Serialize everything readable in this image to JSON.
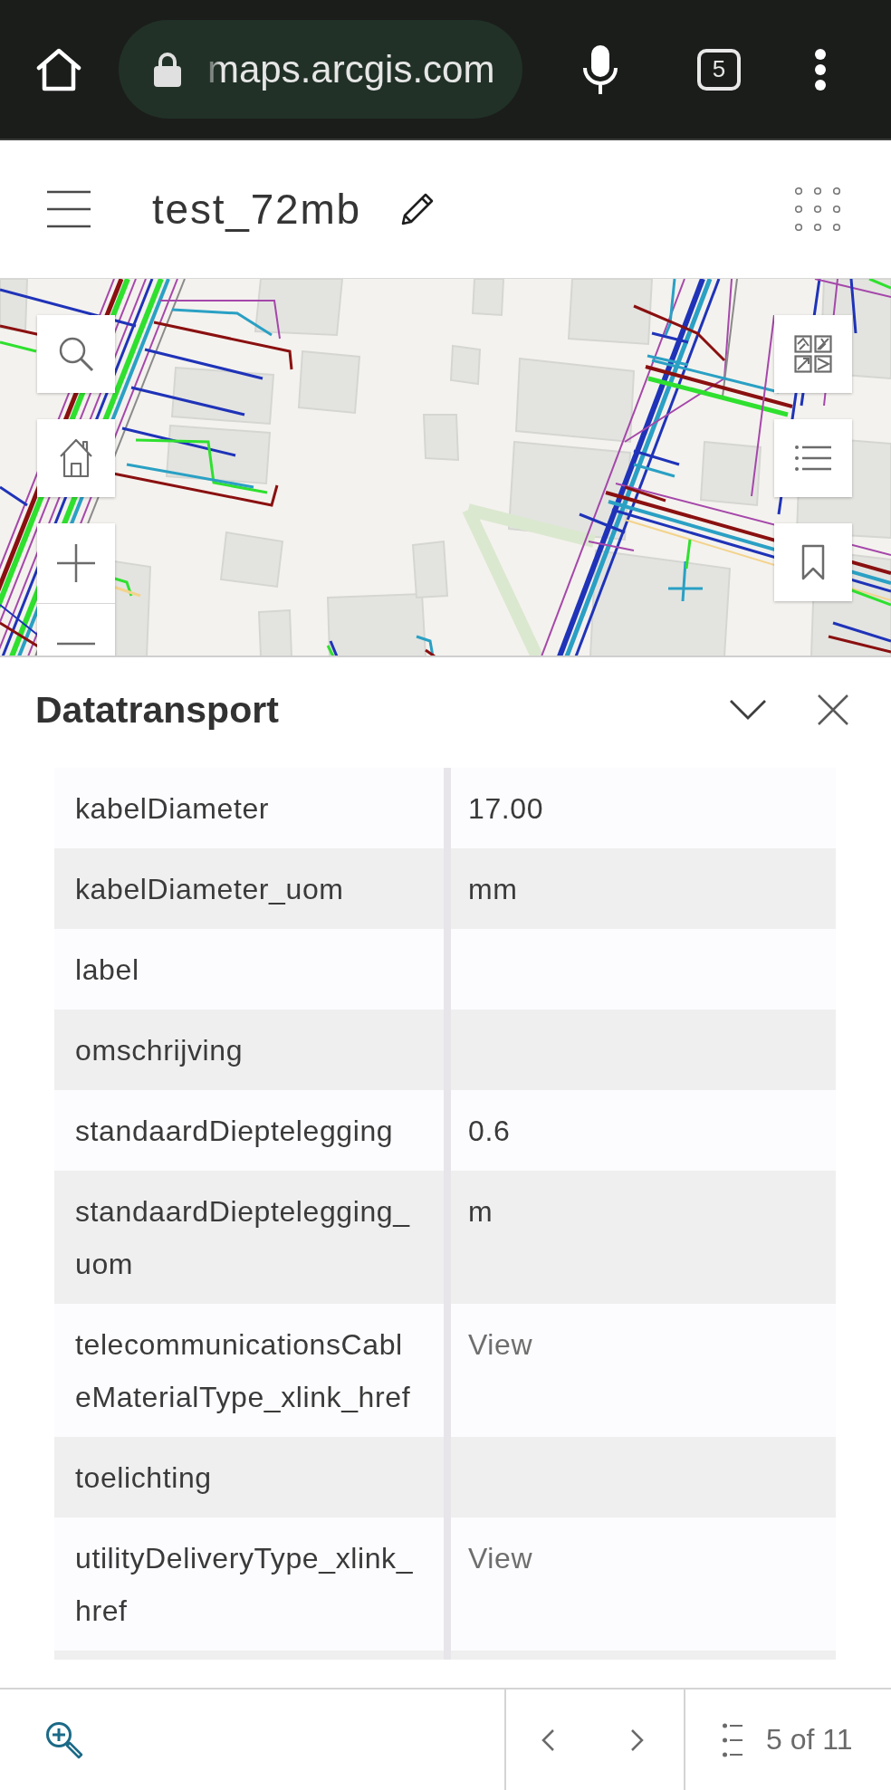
{
  "browser": {
    "url": "maps.arcgis.com",
    "tab_count": "5"
  },
  "app_header": {
    "title": "test_72mb"
  },
  "popup": {
    "title": "Datatransport",
    "fields": [
      {
        "name": "kabelDiameter",
        "value": "17.00",
        "kind": "text"
      },
      {
        "name": "kabelDiameter_uom",
        "value": "mm",
        "kind": "text"
      },
      {
        "name": "label"
      },
      {
        "name": "omschrijving"
      },
      {
        "name": "standaardDieptelegging",
        "value": "0.6",
        "kind": "text"
      },
      {
        "name": "standaardDieptelegging_uom",
        "value": "m",
        "kind": "text"
      },
      {
        "name": "telecommunicationsCableMaterialType_xlink_href",
        "value": "View",
        "kind": "link"
      },
      {
        "name": "toelichting"
      },
      {
        "name": "utilityDeliveryType_xlink_href",
        "value": "View",
        "kind": "link"
      }
    ]
  },
  "pager": {
    "label": "5 of 11"
  }
}
